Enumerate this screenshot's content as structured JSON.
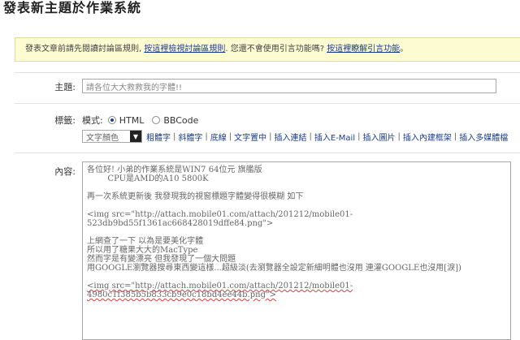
{
  "page": {
    "title": "發表新主題於作業系統"
  },
  "notice": {
    "prefix": "發表文章前請先閱讀討論區規則, ",
    "link_rules": "按這裡檢視討論區規則",
    "middle": ". 您還不會使用引言功能嗎? ",
    "link_quote": "按這裡瞭解引言功能",
    "suffix": "。"
  },
  "subject": {
    "label": "主題:",
    "value": "請各位大大救救我的字體!!"
  },
  "tags": {
    "label": "標籤:",
    "mode_label": "模式:",
    "mode_options": [
      "HTML",
      "BBCode"
    ],
    "selected_mode": "HTML"
  },
  "toolbar": {
    "color_select": "文字顏色",
    "items": [
      "粗體字",
      "斜體字",
      "底線",
      "文字置中",
      "插入連結",
      "插入E-Mail",
      "插入圖片",
      "插入內建框架",
      "插入多媒體檔"
    ]
  },
  "content": {
    "label": "內容:",
    "lines": [
      "各位好! 小弟的作業系統是WIN7 64位元 旗艦版",
      "        CPU是AMD的A10 5800K",
      "",
      "再一次系統更新後 我發現我的視窗標題字體變得很模糊 如下",
      "",
      "<img src=\"http://attach.mobile01.com/attach/201212/mobile01-",
      "523db9bd55f1361ac668428019dffe84.png\">",
      "",
      "上網查了一下 以為是要美化字體",
      "所以用了糖果大大的MacType",
      "然而字是有變漂亮 但我發現了一個大問題",
      "用GOOGLE瀏覽器搜尋東西變這樣...超級淡(去瀏覽器全設定新細明體也沒用 連灌GOOGLE也沒用[淚])",
      "",
      "<img src=\"http://attach.mobile01.com/attach/201212/mobile01-",
      "4980c1f385b5b833cb9e0c18bd4ee44b.png\">"
    ]
  }
}
